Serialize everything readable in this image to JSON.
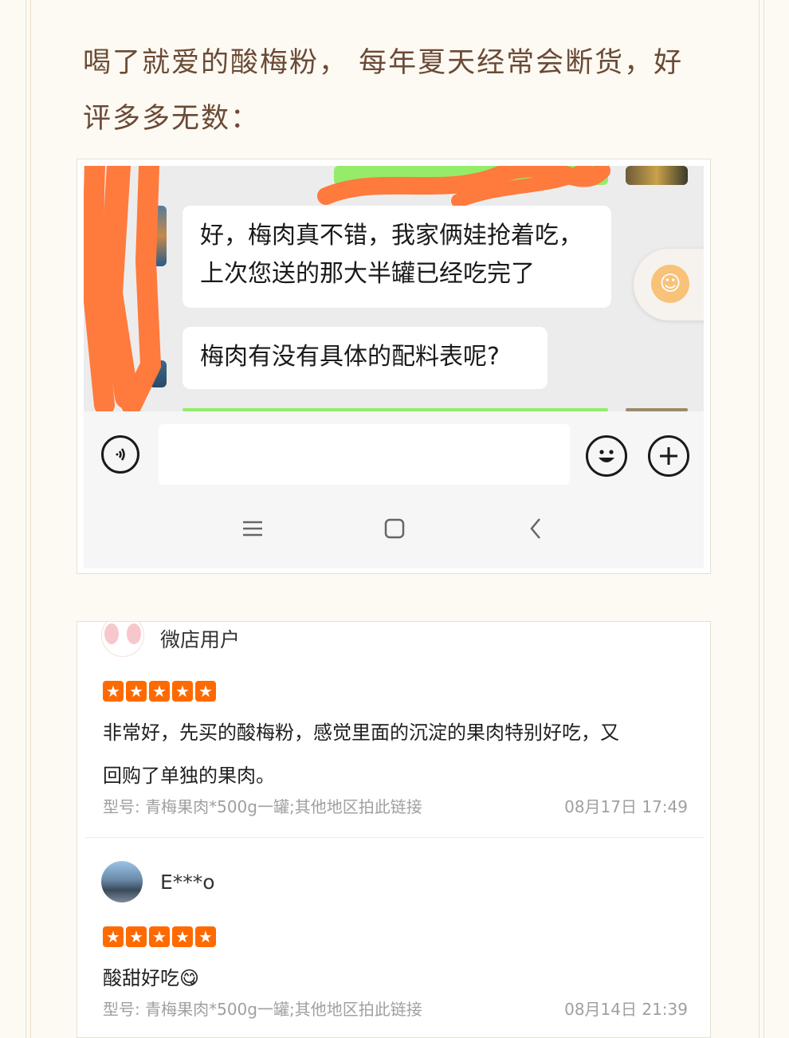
{
  "intro": {
    "line1": "喝了就爱的酸梅粉， 每年夏天经常会断货，好",
    "line2": "评多多无数："
  },
  "chat": {
    "message1_line1": "好，梅肉真不错，我家俩娃抢着吃，",
    "message1_line2": "上次您送的那大半罐已经吃完了",
    "message2": "梅肉有没有具体的配料表呢?",
    "icons": {
      "voice": "voice-icon",
      "emoji": "emoji-icon",
      "plus": "plus-icon",
      "accessibility": "accessibility-icon",
      "nav_menu": "menu-icon",
      "nav_home": "home-icon",
      "nav_back": "back-icon"
    },
    "colors": {
      "sent_bubble": "#95ec69",
      "scribble": "#ff7a3d",
      "accessibility": "#f8c278"
    }
  },
  "reviews": [
    {
      "user": "微店用户",
      "rating": 5,
      "text_line1": "非常好，先买的酸梅粉，感觉里面的沉淀的果肉特别好吃，又",
      "text_line2": "回购了单独的果肉。",
      "variant": "型号: 青梅果肉*500g一罐;其他地区拍此链接",
      "date": "08月17日 17:49"
    },
    {
      "user": "E***o",
      "rating": 5,
      "text_line1": "酸甜好吃😋",
      "variant": "型号: 青梅果肉*500g一罐;其他地区拍此链接",
      "date": "08月14日 21:39"
    }
  ],
  "colors": {
    "star": "#ff6a00",
    "intro_text": "#6b4a36",
    "page_bg": "#fdfaf3"
  }
}
